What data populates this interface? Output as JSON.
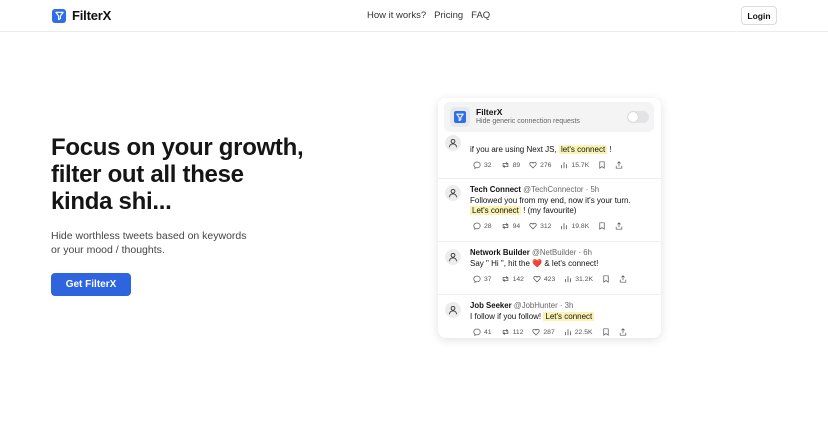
{
  "header": {
    "brand": "FilterX",
    "nav": [
      "How it works?",
      "Pricing",
      "FAQ"
    ],
    "login": "Login"
  },
  "hero": {
    "title_lines": [
      "Focus on your growth,",
      "filter out all these",
      "kinda shi..."
    ],
    "subtitle_lines": [
      "Hide worthless tweets based on keywords",
      "or your mood / thoughts."
    ],
    "cta": "Get FilterX"
  },
  "extension": {
    "title": "FilterX",
    "description": "Hide generic connection requests",
    "enabled": false
  },
  "tweets": [
    {
      "name": "",
      "handle": "",
      "time": "",
      "text_before": "if you are using Next JS,",
      "highlight": "let's connect",
      "text_after": "!",
      "replies": "32",
      "retweets": "89",
      "likes": "276",
      "views": "15.7K"
    },
    {
      "name": "Tech Connect",
      "handle": "@TechConnector",
      "time": "5h",
      "text_before": "Followed you from my end, now it's your turn.",
      "highlight": "Let's connect",
      "text_after": "! (my favourite)",
      "replies": "28",
      "retweets": "94",
      "likes": "312",
      "views": "19.8K"
    },
    {
      "name": "Network Builder",
      "handle": "@NetBuilder",
      "time": "6h",
      "text_before": "Say \" Hi \", hit the",
      "heart": "❤️",
      "text_after": "& let's connect!",
      "replies": "37",
      "retweets": "142",
      "likes": "423",
      "views": "31.2K"
    },
    {
      "name": "Job Seeker",
      "handle": "@JobHunter",
      "time": "3h",
      "text_before": "I follow if you follow!",
      "highlight": "Let's connect",
      "text_after": "",
      "replies": "41",
      "retweets": "112",
      "likes": "287",
      "views": "22.5K"
    }
  ],
  "colors": {
    "accent": "#2f64df",
    "highlight": "#fbf3b4",
    "heart": "#e0245e"
  }
}
